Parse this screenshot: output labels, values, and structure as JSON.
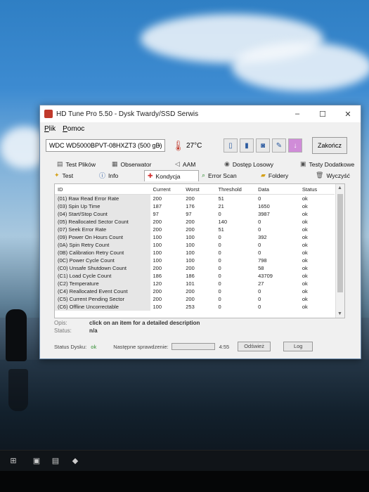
{
  "window": {
    "title": "HD Tune Pro 5.50 - Dysk Twardy/SSD Serwis",
    "minimize": "–",
    "maximize": "☐",
    "close": "✕"
  },
  "menu": [
    "Plik",
    "Pomoc"
  ],
  "toolbar": {
    "drive": "WDC WD5000BPVT-08HXZT3 (500 gB)",
    "temperature": "27°C",
    "exit_label": "Zakończ"
  },
  "tabs_row1": [
    {
      "label": "Test Plików",
      "icon": "file-icon"
    },
    {
      "label": "Obserwator",
      "icon": "monitor-icon"
    },
    {
      "label": "AAM",
      "icon": "speaker-icon"
    },
    {
      "label": "Dostęp Losowy",
      "icon": "random-access-icon"
    },
    {
      "label": "Testy Dodatkowe",
      "icon": "extra-tests-icon"
    }
  ],
  "tabs_row2": [
    {
      "label": "Test",
      "icon": "bulb-icon"
    },
    {
      "label": "Info",
      "icon": "info-icon"
    },
    {
      "label": "Kondycja",
      "icon": "health-cross-icon",
      "active": true
    },
    {
      "label": "Error Scan",
      "icon": "magnifier-icon"
    },
    {
      "label": "Foldery",
      "icon": "folder-icon"
    },
    {
      "label": "Wyczyść",
      "icon": "trash-icon"
    }
  ],
  "table": {
    "columns": [
      "ID",
      "Current",
      "Worst",
      "Threshold",
      "Data",
      "Status"
    ],
    "rows": [
      [
        "(01) Raw Read Error Rate",
        "200",
        "200",
        "51",
        "0",
        "ok"
      ],
      [
        "(03) Spin Up Time",
        "187",
        "176",
        "21",
        "1650",
        "ok"
      ],
      [
        "(04) Start/Stop Count",
        "97",
        "97",
        "0",
        "3987",
        "ok"
      ],
      [
        "(05) Reallocated Sector Count",
        "200",
        "200",
        "140",
        "0",
        "ok"
      ],
      [
        "(07) Seek Error Rate",
        "200",
        "200",
        "51",
        "0",
        "ok"
      ],
      [
        "(09) Power On Hours Count",
        "100",
        "100",
        "0",
        "392",
        "ok"
      ],
      [
        "(0A) Spin Retry Count",
        "100",
        "100",
        "0",
        "0",
        "ok"
      ],
      [
        "(0B) Calibration Retry Count",
        "100",
        "100",
        "0",
        "0",
        "ok"
      ],
      [
        "(0C) Power Cycle Count",
        "100",
        "100",
        "0",
        "798",
        "ok"
      ],
      [
        "(C0) Unsafe Shutdown Count",
        "200",
        "200",
        "0",
        "58",
        "ok"
      ],
      [
        "(C1) Load Cycle Count",
        "186",
        "186",
        "0",
        "43709",
        "ok"
      ],
      [
        "(C2) Temperature",
        "120",
        "101",
        "0",
        "27",
        "ok"
      ],
      [
        "(C4) Reallocated Event Count",
        "200",
        "200",
        "0",
        "0",
        "ok"
      ],
      [
        "(C5) Current Pending Sector",
        "200",
        "200",
        "0",
        "0",
        "ok"
      ],
      [
        "(C6) Offline Uncorrectable",
        "100",
        "253",
        "0",
        "0",
        "ok"
      ]
    ]
  },
  "details": {
    "desc_label": "Opis:",
    "desc_value": "click on an item for a detailed description",
    "status_label": "Status:",
    "status_value": "n/a"
  },
  "statusbar": {
    "disk_status_label": "Status Dysku:",
    "disk_status_value": "ok",
    "next_check_label": "Następne sprawdzenie:",
    "next_check_time": "4:55",
    "refresh_label": "Odśwież",
    "log_label": "Log"
  },
  "colors": {
    "ok": "#2e8b2e",
    "accent": "#c0392b"
  }
}
